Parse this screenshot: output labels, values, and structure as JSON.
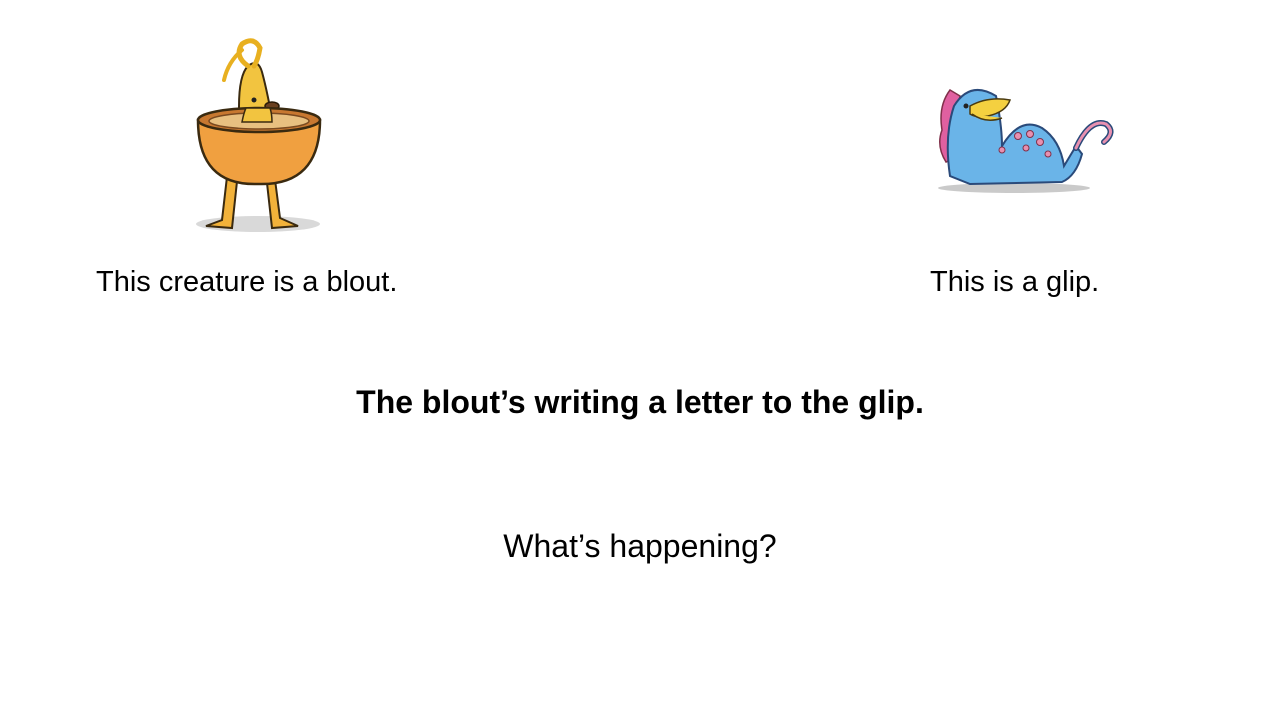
{
  "slide": {
    "blout": {
      "caption": "This creature is a blout.",
      "illustration": "blout-creature-illustration"
    },
    "glip": {
      "caption": "This is a glip.",
      "illustration": "glip-creature-illustration"
    },
    "sentence": "The blout’s writing a letter to the glip.",
    "question": "What’s happening?"
  },
  "colors": {
    "background": "#ffffff",
    "text": "#000000",
    "blout_body": "#f0a040",
    "blout_face": "#f2c440",
    "glip_body": "#6ab4e8",
    "glip_beak": "#f4d040",
    "glip_spots": "#e890b0"
  }
}
